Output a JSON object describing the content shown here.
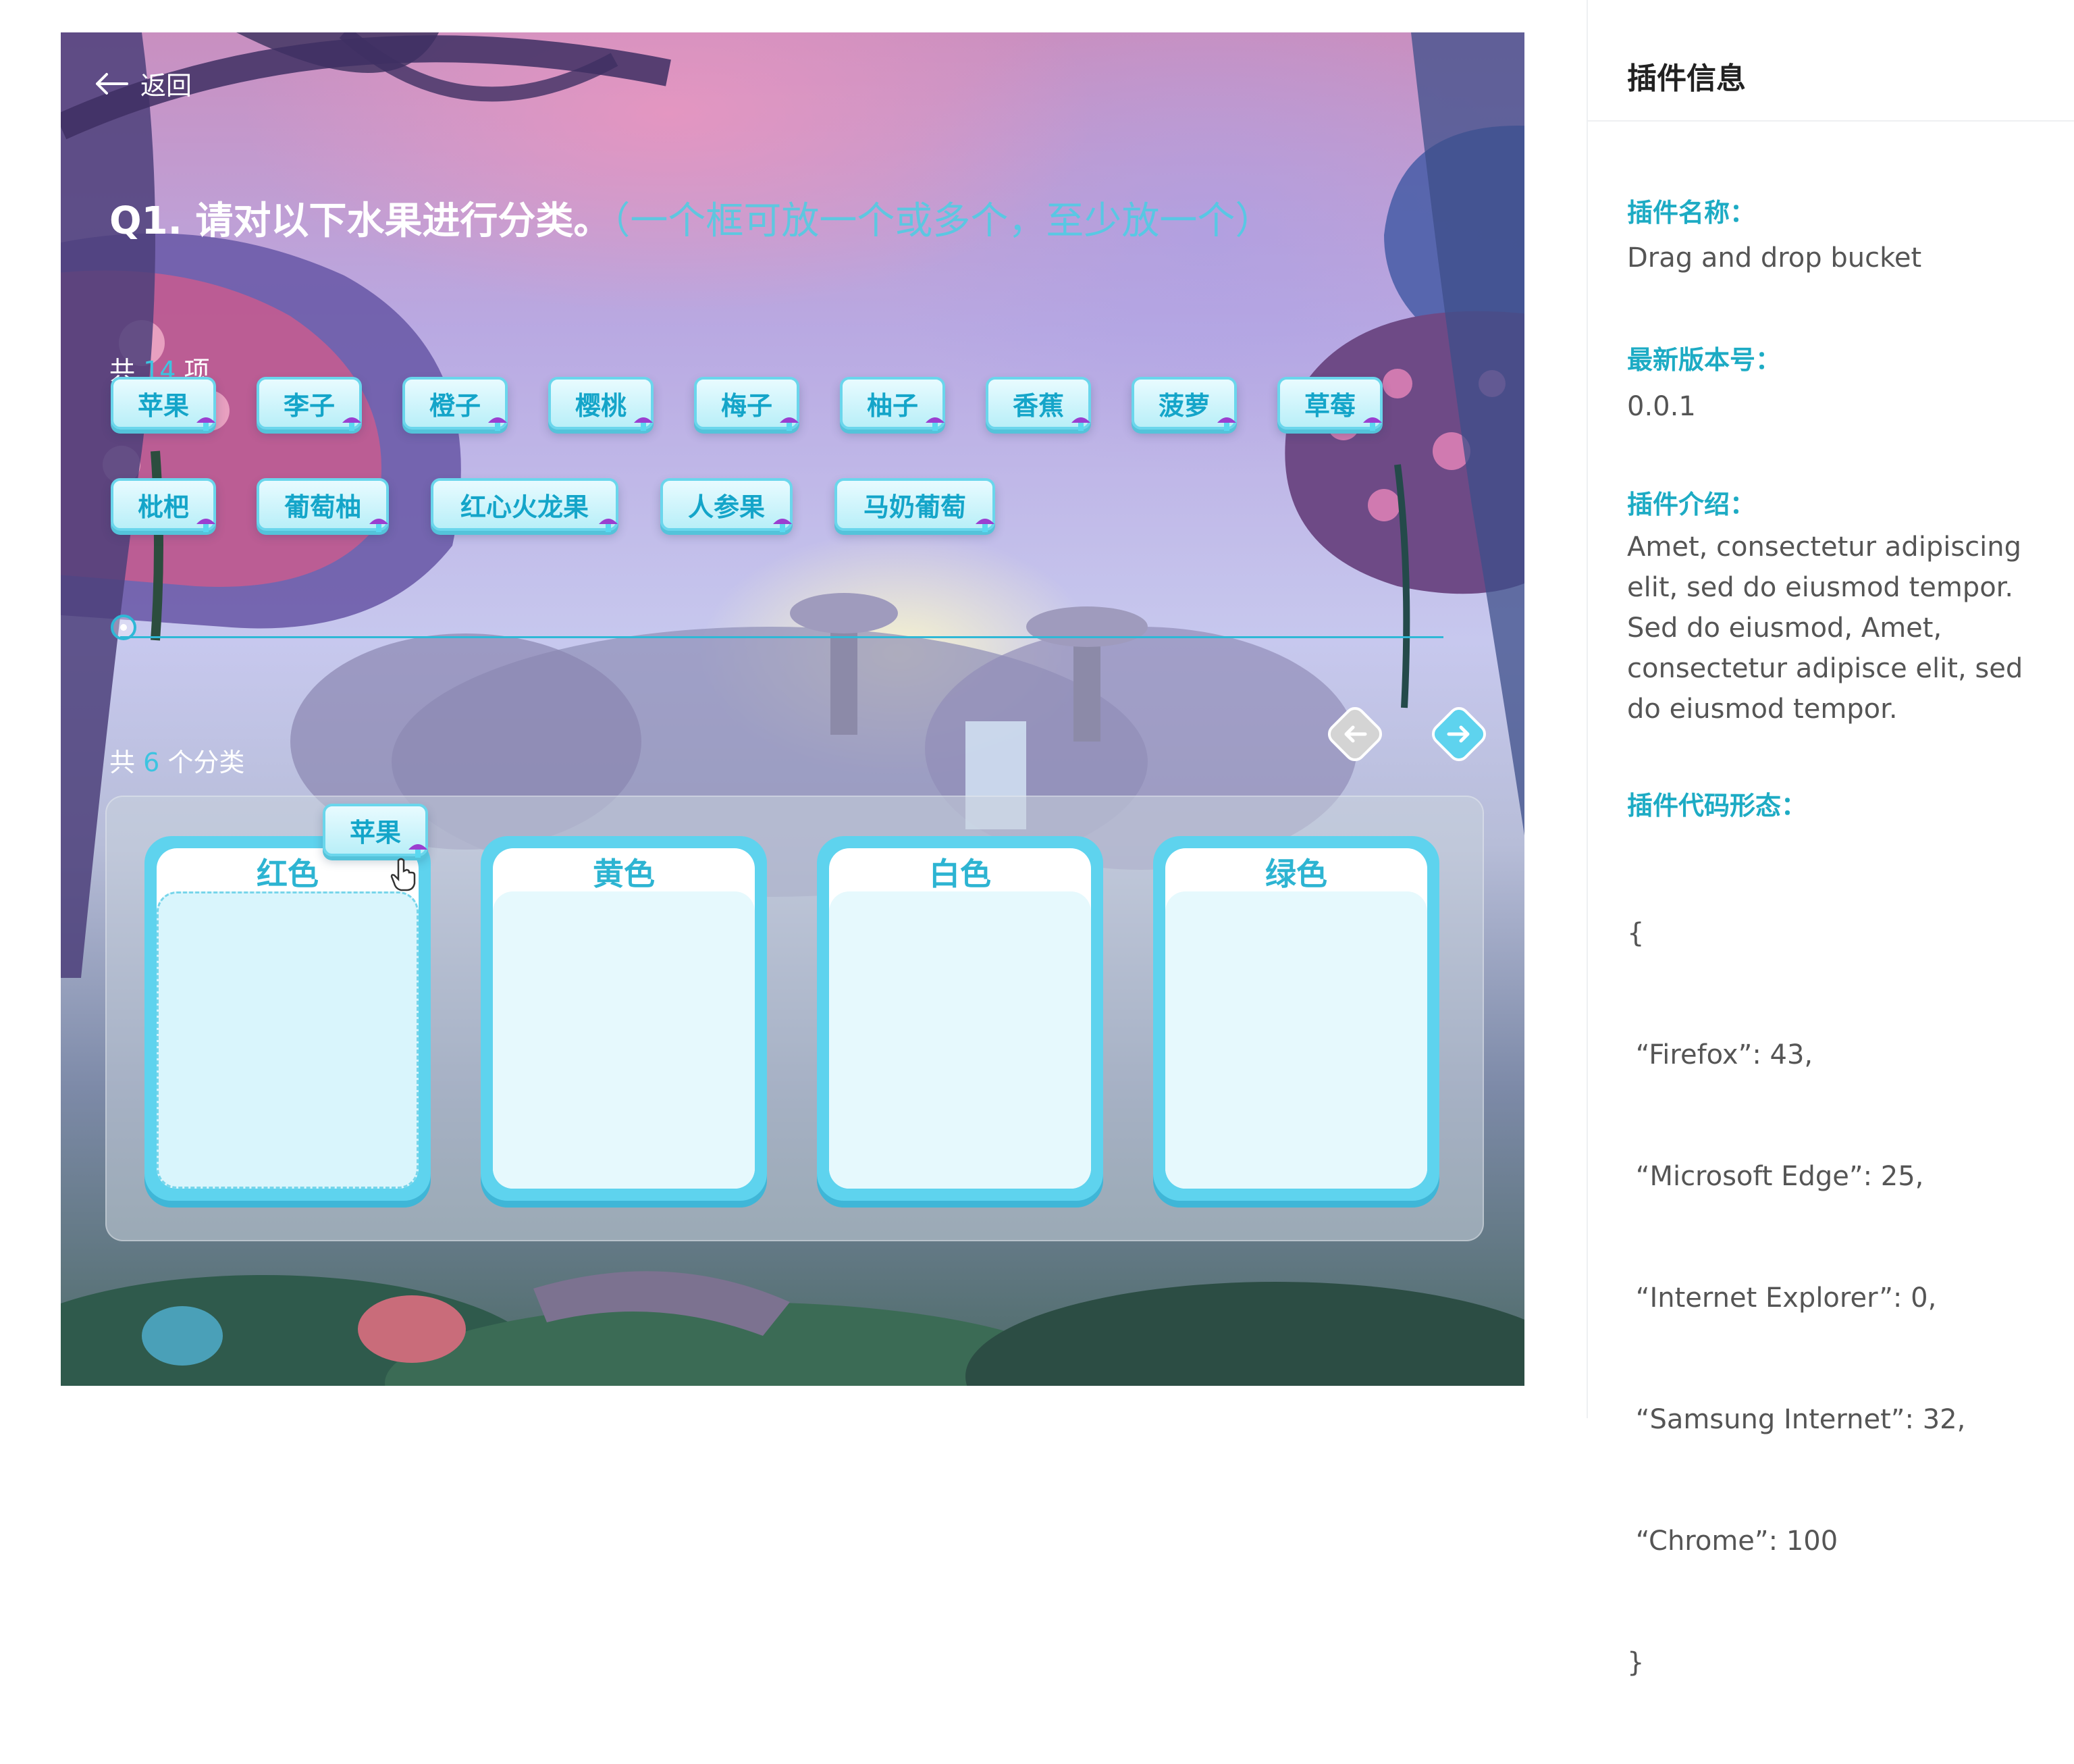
{
  "stage": {
    "back_label": "返回",
    "question_main": "Q1. 请对以下水果进行分类。",
    "question_hint": "（一个框可放一个或多个，至少放一个）",
    "items_count": {
      "prefix": "共",
      "num": "14",
      "suffix": "项"
    },
    "items": [
      "苹果",
      "李子",
      "橙子",
      "樱桃",
      "梅子",
      "柚子",
      "香蕉",
      "菠萝",
      "草莓",
      "枇杷",
      "葡萄柚",
      "红心火龙果",
      "人参果",
      "马奶葡萄"
    ],
    "categories_count": {
      "prefix": "共",
      "num": "6",
      "suffix": "个分类"
    },
    "buckets": [
      "红色",
      "黄色",
      "白色",
      "绿色"
    ],
    "dragging_item": "苹果",
    "accent_color": "#2db4d2"
  },
  "sidebar": {
    "title": "插件信息",
    "name_label": "插件名称：",
    "name_value": "Drag and drop bucket",
    "version_label": "最新版本号：",
    "version_value": "0.0.1",
    "intro_label": "插件介绍：",
    "intro_value": "Amet, consectetur adipiscing elit, sed do eiusmod tempor. Sed do eiusmod, Amet, consectetur adipisce elit, sed do eiusmod tempor.",
    "code_label": "插件代码形态：",
    "code_lines": [
      "{",
      " “Firefox”: 43,",
      " “Microsoft Edge”: 25,",
      " “Internet Explorer”: 0,",
      " “Samsung Internet”: 32,",
      " “Chrome”: 100",
      "}"
    ]
  }
}
